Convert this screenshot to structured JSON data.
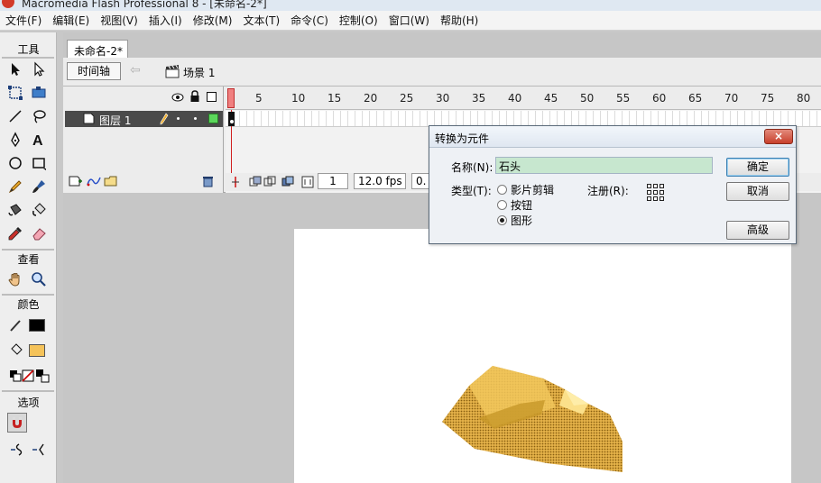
{
  "window": {
    "title": "Macromedia Flash Professional 8 - [未命名-2*]"
  },
  "menubar": {
    "items": [
      "文件(F)",
      "编辑(E)",
      "视图(V)",
      "插入(I)",
      "修改(M)",
      "文本(T)",
      "命令(C)",
      "控制(O)",
      "窗口(W)",
      "帮助(H)"
    ]
  },
  "tools": {
    "title": "工具",
    "view_label": "查看",
    "color_label": "颜色",
    "options_label": "选项",
    "stroke_color": "#000000",
    "fill_color": "#f5c35a"
  },
  "document": {
    "tab_label": "未命名-2*",
    "timeline_button": "时间轴",
    "scene_label": "场景 1"
  },
  "timeline": {
    "layer_name": "图层 1",
    "ruler_ticks": [
      "1",
      "5",
      "10",
      "15",
      "20",
      "25",
      "30",
      "35",
      "40",
      "45",
      "50",
      "55",
      "60",
      "65",
      "70",
      "75",
      "80"
    ],
    "current_frame": "1",
    "frame_rate": "12.0 fps",
    "elapsed": "0."
  },
  "dialog": {
    "title": "转换为元件",
    "close_label": "×",
    "name_label": "名称(N):",
    "name_value": "石头",
    "type_label": "类型(T):",
    "type_options": [
      {
        "label": "影片剪辑",
        "checked": false
      },
      {
        "label": "按钮",
        "checked": false
      },
      {
        "label": "图形",
        "checked": true
      }
    ],
    "registration_label": "注册(R):",
    "ok_label": "确定",
    "cancel_label": "取消",
    "advanced_label": "高级"
  },
  "stage": {
    "background": "#ffffff",
    "shape_color": "#d9a33a"
  }
}
